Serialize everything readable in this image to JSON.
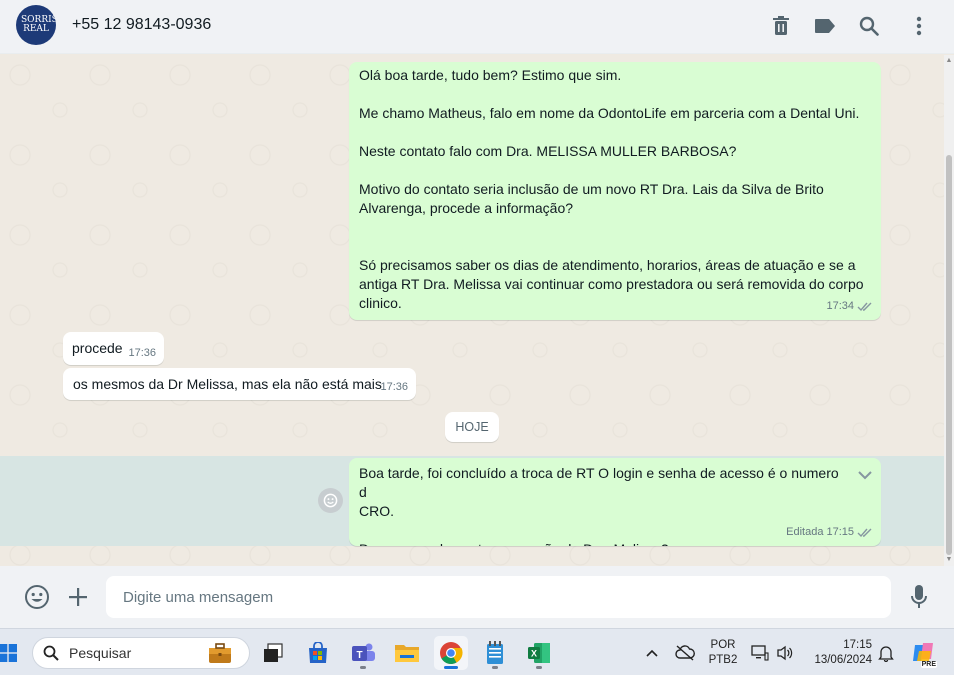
{
  "header": {
    "avatar_text": "SORRISO REAL",
    "contact": "+55 12 98143-0936",
    "icons": [
      "trash-icon",
      "label-icon",
      "search-icon",
      "menu-icon"
    ]
  },
  "messages": {
    "m1": {
      "text": "Olá boa tarde, tudo bem? Estimo que sim.\n\nMe chamo Matheus, falo em nome da OdontoLife em parceria com a Dental Uni.\n\nNeste contato falo com Dra. MELISSA MULLER BARBOSA?\n\nMotivo do contato seria inclusão de um novo RT Dra. Lais da Silva de Brito\nAlvarenga, procede a informação?\n\n\nSó precisamos saber os dias de atendimento, horarios, áreas de atuação e se a\nantiga RT Dra. Melissa vai continuar como prestadora ou será removida do corpo\nclinico.",
      "time": "17:34"
    },
    "m2": {
      "text": "procede",
      "time": "17:36"
    },
    "m3": {
      "text": "os mesmos da Dr Melissa, mas ela não está mais",
      "time": "17:36"
    },
    "date_divider": "HOJE",
    "m4": {
      "text": "Boa tarde, foi concluído a troca de RT O login e senha de acesso é o numero d\nCRO.\n\nDaremos andamento a remoção da Dra. Melissa?",
      "edited": "Editada",
      "time": "17:15"
    }
  },
  "composer": {
    "placeholder": "Digite uma mensagem"
  },
  "taskbar": {
    "search_placeholder": "Pesquisar",
    "lang_line1": "POR",
    "lang_line2": "PTB2",
    "time": "17:15",
    "date": "13/06/2024",
    "copilot_badge": "PRE"
  },
  "colors": {
    "outgoing_bubble": "#d9fdd3",
    "incoming_bubble": "#ffffff",
    "chat_bg": "#efeae2",
    "header_bg": "#f0f2f5",
    "read_tick": "#8696a0"
  }
}
